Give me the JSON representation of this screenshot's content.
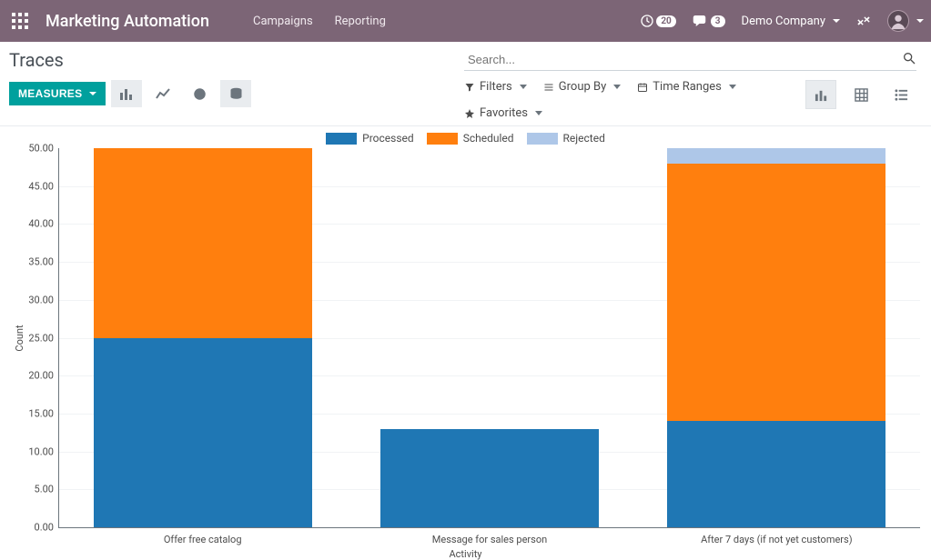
{
  "navbar": {
    "brand": "Marketing Automation",
    "links": [
      "Campaigns",
      "Reporting"
    ],
    "clock_badge": "20",
    "chat_badge": "3",
    "company": "Demo Company"
  },
  "page": {
    "title": "Traces"
  },
  "search": {
    "placeholder": "Search..."
  },
  "toolbar": {
    "measures_label": "MEASURES"
  },
  "filters": {
    "filters_label": "Filters",
    "groupby_label": "Group By",
    "time_label": "Time Ranges",
    "favorites_label": "Favorites"
  },
  "chart_data": {
    "type": "bar",
    "stacked": true,
    "title": "",
    "xlabel": "Activity",
    "ylabel": "Count",
    "ylim": [
      0,
      50
    ],
    "ytick_step": 5,
    "categories": [
      "Offer free catalog",
      "Message for sales person",
      "After 7 days (if not yet customers)"
    ],
    "series": [
      {
        "name": "Processed",
        "color": "#1f77b4",
        "values": [
          25,
          13,
          14
        ]
      },
      {
        "name": "Scheduled",
        "color": "#ff7f0e",
        "values": [
          25,
          0,
          34
        ]
      },
      {
        "name": "Rejected",
        "color": "#aec7e8",
        "values": [
          0,
          0,
          2
        ]
      }
    ]
  }
}
